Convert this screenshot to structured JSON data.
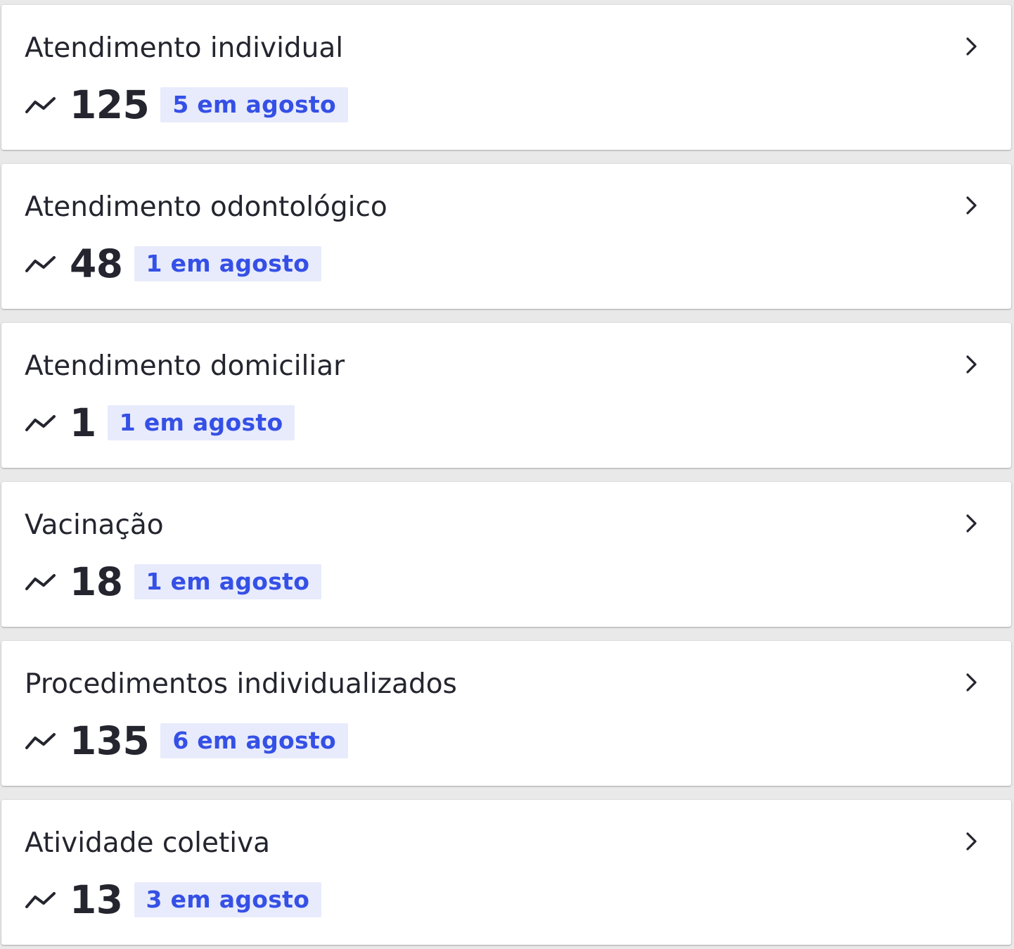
{
  "cards": [
    {
      "title": "Atendimento individual",
      "count": "125",
      "badge": "5 em agosto",
      "icons": {
        "trend": "trending-line-icon",
        "chevron": "chevron-right-icon"
      }
    },
    {
      "title": "Atendimento odontológico",
      "count": "48",
      "badge": "1 em agosto",
      "icons": {
        "trend": "trending-line-icon",
        "chevron": "chevron-right-icon"
      }
    },
    {
      "title": "Atendimento domiciliar",
      "count": "1",
      "badge": "1 em agosto",
      "icons": {
        "trend": "trending-line-icon",
        "chevron": "chevron-right-icon"
      }
    },
    {
      "title": "Vacinação",
      "count": "18",
      "badge": "1 em agosto",
      "icons": {
        "trend": "trending-line-icon",
        "chevron": "chevron-right-icon"
      }
    },
    {
      "title": "Procedimentos individualizados",
      "count": "135",
      "badge": "6 em agosto",
      "icons": {
        "trend": "trending-line-icon",
        "chevron": "chevron-right-icon"
      }
    },
    {
      "title": "Atividade coletiva",
      "count": "13",
      "badge": "3 em agosto",
      "icons": {
        "trend": "trending-line-icon",
        "chevron": "chevron-right-icon"
      }
    }
  ],
  "colors": {
    "background": "#e9e9e9",
    "card": "#ffffff",
    "text": "#24252e",
    "badge_background": "#e8ebfb",
    "badge_text": "#3550e6"
  }
}
